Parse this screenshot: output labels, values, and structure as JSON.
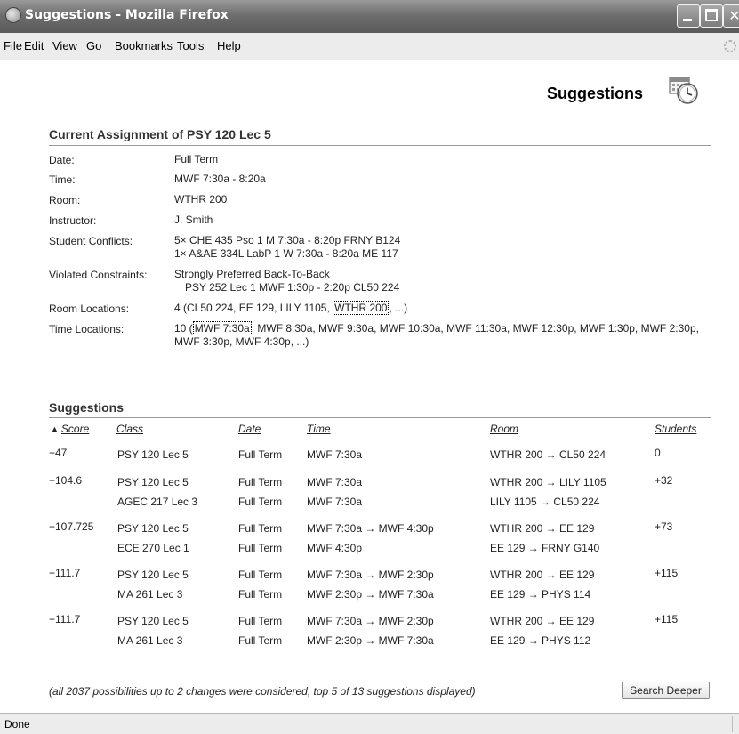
{
  "window": {
    "title": "Suggestions - Mozilla Firefox"
  },
  "menu": [
    "File",
    "Edit",
    "View",
    "Go",
    "Bookmarks",
    "Tools",
    "Help"
  ],
  "page": {
    "title": "Suggestions"
  },
  "assignment": {
    "heading": "Current Assignment of PSY 120 Lec 5",
    "date_label": "Date:",
    "date": "Full Term",
    "time_label": "Time:",
    "time": "MWF 7:30a - 8:20a",
    "room_label": "Room:",
    "room": "WTHR 200",
    "instructor_label": "Instructor:",
    "instructor": "J. Smith",
    "conflicts_label": "Student Conflicts:",
    "conflicts": [
      "5× CHE 435 Pso 1 M 7:30a - 8:20p FRNY B124",
      "1× A&AE 334L LabP 1 W 7:30a - 8:20a ME 117"
    ],
    "violated_label": "Violated Constraints:",
    "violated": "Strongly Preferred Back-To-Back",
    "violated_detail": "PSY 252 Lec 1 MWF 1:30p - 2:20p CL50 224",
    "room_locations_label": "Room Locations:",
    "room_locations_prefix": "4 (CL50 224, EE 129, LILY 1105,",
    "room_locations_selected": "WTHR 200",
    "room_locations_suffix": ", ...)",
    "time_locations_label": "Time Locations:",
    "time_locations_prefix": "10 (",
    "time_locations_selected": "MWF 7:30a",
    "time_locations_suffix": ", MWF 8:30a, MWF 9:30a, MWF 10:30a, MWF 11:30a, MWF 12:30p, MWF 1:30p, MWF 2:30p, MWF 3:30p, MWF 4:30p, ...)"
  },
  "suggestions": {
    "heading": "Suggestions",
    "columns": [
      "Score",
      "Class",
      "Date",
      "Time",
      "Room",
      "Students"
    ],
    "rows": [
      {
        "score": "+47",
        "students": "0",
        "lines": [
          {
            "class": "PSY 120 Lec 5",
            "date": "Full Term",
            "time": "MWF 7:30a",
            "room": "WTHR 200 → CL50 224"
          }
        ]
      },
      {
        "score": "+104.6",
        "students": "+32",
        "lines": [
          {
            "class": "PSY 120 Lec 5",
            "date": "Full Term",
            "time": "MWF 7:30a",
            "room": "WTHR 200 → LILY 1105"
          },
          {
            "class": "AGEC 217 Lec 3",
            "date": "Full Term",
            "time": "MWF 7:30a",
            "room": "LILY 1105 → CL50 224"
          }
        ]
      },
      {
        "score": "+107.725",
        "students": "+73",
        "lines": [
          {
            "class": "PSY 120 Lec 5",
            "date": "Full Term",
            "time": "MWF 7:30a → MWF 4:30p",
            "room": "WTHR 200 → EE 129"
          },
          {
            "class": "ECE 270 Lec 1",
            "date": "Full Term",
            "time": "MWF 4:30p",
            "room": "EE 129 → FRNY G140"
          }
        ]
      },
      {
        "score": "+111.7",
        "students": "+115",
        "lines": [
          {
            "class": "PSY 120 Lec 5",
            "date": "Full Term",
            "time": "MWF 7:30a → MWF 2:30p",
            "room": "WTHR 200 → EE 129"
          },
          {
            "class": "MA 261 Lec 3",
            "date": "Full Term",
            "time": "MWF 2:30p → MWF 7:30a",
            "room": "EE 129 → PHYS 114"
          }
        ]
      },
      {
        "score": "+111.7",
        "students": "+115",
        "lines": [
          {
            "class": "PSY 120 Lec 5",
            "date": "Full Term",
            "time": "MWF 7:30a → MWF 2:30p",
            "room": "WTHR 200 → EE 129"
          },
          {
            "class": "MA 261 Lec 3",
            "date": "Full Term",
            "time": "MWF 2:30p → MWF 7:30a",
            "room": "EE 129 → PHYS 112"
          }
        ]
      }
    ],
    "footnote": "(all 2037 possibilities up to 2 changes were considered, top 5 of 13 suggestions displayed)",
    "search_button": "Search Deeper"
  },
  "status": {
    "text": "Done"
  }
}
